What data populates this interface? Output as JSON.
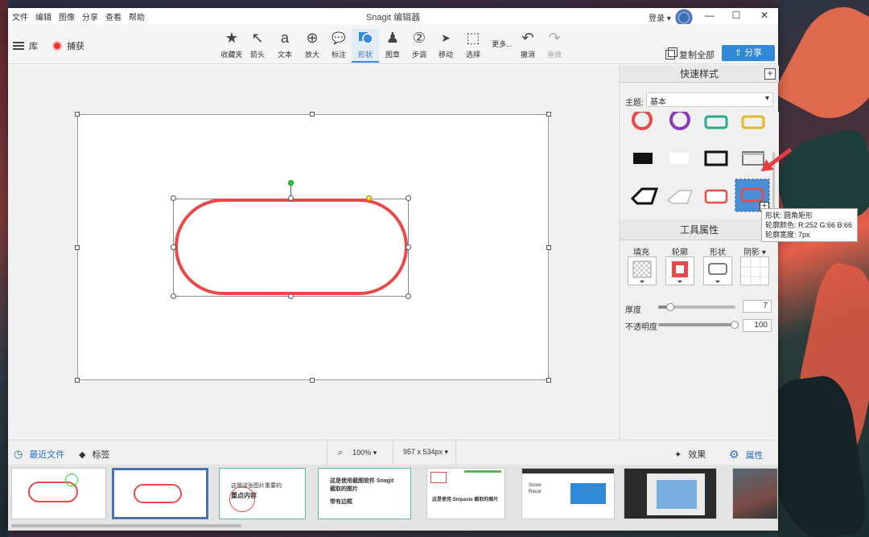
{
  "app": {
    "title": "Snagit 编辑器",
    "menu": [
      "文件",
      "编辑",
      "图像",
      "分享",
      "查看",
      "帮助"
    ],
    "login": "登录 ▾",
    "window_controls": [
      "minimize-icon",
      "maximize-icon",
      "close-icon"
    ]
  },
  "toolbar": {
    "library_label": "库",
    "capture_label": "捕获",
    "tools": [
      {
        "id": "favorites",
        "label": "收藏夹",
        "icon": "★"
      },
      {
        "id": "arrow",
        "label": "箭头",
        "icon": "↖"
      },
      {
        "id": "text",
        "label": "文本",
        "icon": "a"
      },
      {
        "id": "magnify",
        "label": "放大",
        "icon": "⊕"
      },
      {
        "id": "callout",
        "label": "标注",
        "icon": "💬"
      },
      {
        "id": "shape",
        "label": "形状",
        "icon": "■"
      },
      {
        "id": "stamp",
        "label": "图章",
        "icon": "♟"
      },
      {
        "id": "step",
        "label": "步调",
        "icon": "②"
      },
      {
        "id": "move",
        "label": "移动",
        "icon": "➤"
      },
      {
        "id": "select",
        "label": "选择",
        "icon": "⬚"
      },
      {
        "id": "more",
        "label": "更多...",
        "icon": ""
      },
      {
        "id": "undo",
        "label": "撤消",
        "icon": "↶"
      },
      {
        "id": "redo",
        "label": "重做",
        "icon": "↷"
      }
    ],
    "active_tool": "shape",
    "copy_all_label": "复制全部",
    "share_label": "分享"
  },
  "quick_styles": {
    "header": "快速样式",
    "theme_label": "主题:",
    "theme_value": "基本",
    "swatch_colors": {
      "red": "#e84a4a",
      "purple": "#8a3ab8",
      "teal": "#23a98e",
      "yellow": "#e6b626",
      "selected_bg": "#4a8fd6"
    }
  },
  "tooltip": {
    "line1": "形状: 圆角矩形",
    "line2": "轮廓颜色: R:252 G:66 B:66",
    "line3": "轮廓宽度: 7px"
  },
  "tool_props": {
    "header": "工具属性",
    "fill_label": "填充",
    "outline_label": "轮廓",
    "shape_label": "形状",
    "shadow_label": "阴影 ▾",
    "thickness_label": "厚度",
    "thickness_value": "7",
    "opacity_label": "不透明度",
    "opacity_value": "100"
  },
  "bottom": {
    "recent_label": "最近文件",
    "tags_label": "标签",
    "zoom": "100% ▾",
    "size": "957 x 534px ▾",
    "effects_label": "效果",
    "properties_label": "属性"
  },
  "thumbnails": [
    {
      "text": ""
    },
    {
      "text": ""
    },
    {
      "text1": "这是这张图片重要的",
      "text2": "重点内容"
    },
    {
      "text1": "这是使用截图软件 Snagit",
      "text2": "截取的图片",
      "text3": "带有边框"
    },
    {
      "text1": "这是使用 Snipaste 截取的图片"
    },
    {
      "text1": "Scree",
      "text2": "Recor"
    },
    {
      "text": ""
    },
    {
      "text": ""
    }
  ]
}
